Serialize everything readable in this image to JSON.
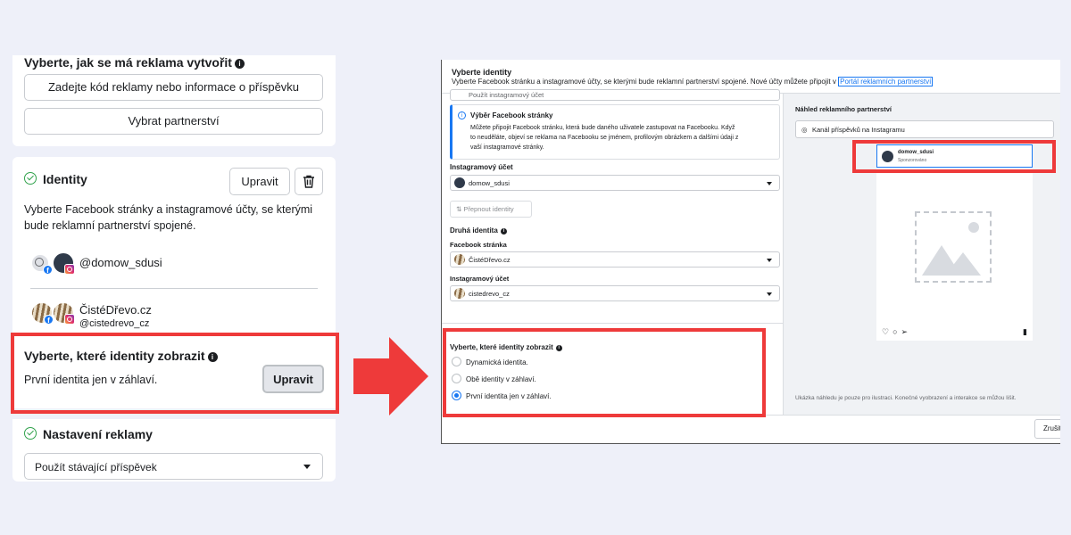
{
  "left": {
    "create_section": {
      "title": "Vyberte, jak se má reklama vytvořit",
      "code_button": "Zadejte kód reklamy nebo informace o příspěvku",
      "partnership_button": "Vybrat partnerství"
    },
    "identity_section": {
      "title": "Identity",
      "edit_button": "Upravit",
      "description_line1": "Vyberte Facebook stránky a instagramové účty, se kterými",
      "description_line2": "bude reklamní partnerství spojené.",
      "identities": [
        {
          "name": "@domow_sdusi"
        },
        {
          "name": "ČistéDřevo.cz",
          "handle": "@cistedrevo_cz"
        }
      ]
    },
    "display_section": {
      "title": "Vyberte, které identity zobrazit",
      "value": "První identita jen v záhlaví.",
      "edit_button": "Upravit"
    },
    "ad_settings": {
      "title": "Nastavení reklamy",
      "select_value": "Použít stávající příspěvek"
    }
  },
  "right": {
    "header_title": "Vyberte identity",
    "header_text": "Vyberte Facebook stránku a instagramové účty, se kterými bude reklamní partnerství spojené. Nové účty můžete připojit v",
    "header_link": "Portál reklamních partnerství",
    "truncated_select": "Použít instagramový účet",
    "info_box": {
      "title": "Výběr Facebook stránky",
      "line1": "Můžete připojit Facebook stránku, která bude daného uživatele zastupovat na Facebooku. Když",
      "line2": "to neuděláte, objeví se reklama na Facebooku se jménem, profilovým obrázkem a dalšími údaji z",
      "line3": "vaší instagramové stránky."
    },
    "ig_account_label": "Instagramový účet",
    "ig_account_value": "domow_sdusi",
    "switch_button": "Přepnout identity",
    "second_identity_title": "Druhá identita",
    "fb_page_label": "Facebook stránka",
    "fb_page_value": "ČistéDřevo.cz",
    "ig_account2_label": "Instagramový účet",
    "ig_account2_value": "cistedrevo_cz",
    "display_title": "Vyberte, které identity zobrazit",
    "options": [
      {
        "label": "Dynamická identita.",
        "selected": false
      },
      {
        "label": "Obě identity v záhlaví.",
        "selected": false
      },
      {
        "label": "První identita jen v záhlaví.",
        "selected": true
      }
    ],
    "preview": {
      "title": "Náhled reklamního partnerství",
      "placement": "Kanál příspěvků na Instagramu",
      "account": "domow_sdusi",
      "sponsored": "Sponzorováno",
      "disclaimer": "Ukázka náhledu je pouze pro ilustraci. Konečné vyobrazení a interakce se můžou lišit."
    },
    "cancel_button": "Zrušit"
  },
  "colors": {
    "highlight": "#ee3a3a",
    "brand_blue": "#1877f2",
    "success_green": "#31a24c",
    "background": "#eef0f9"
  }
}
